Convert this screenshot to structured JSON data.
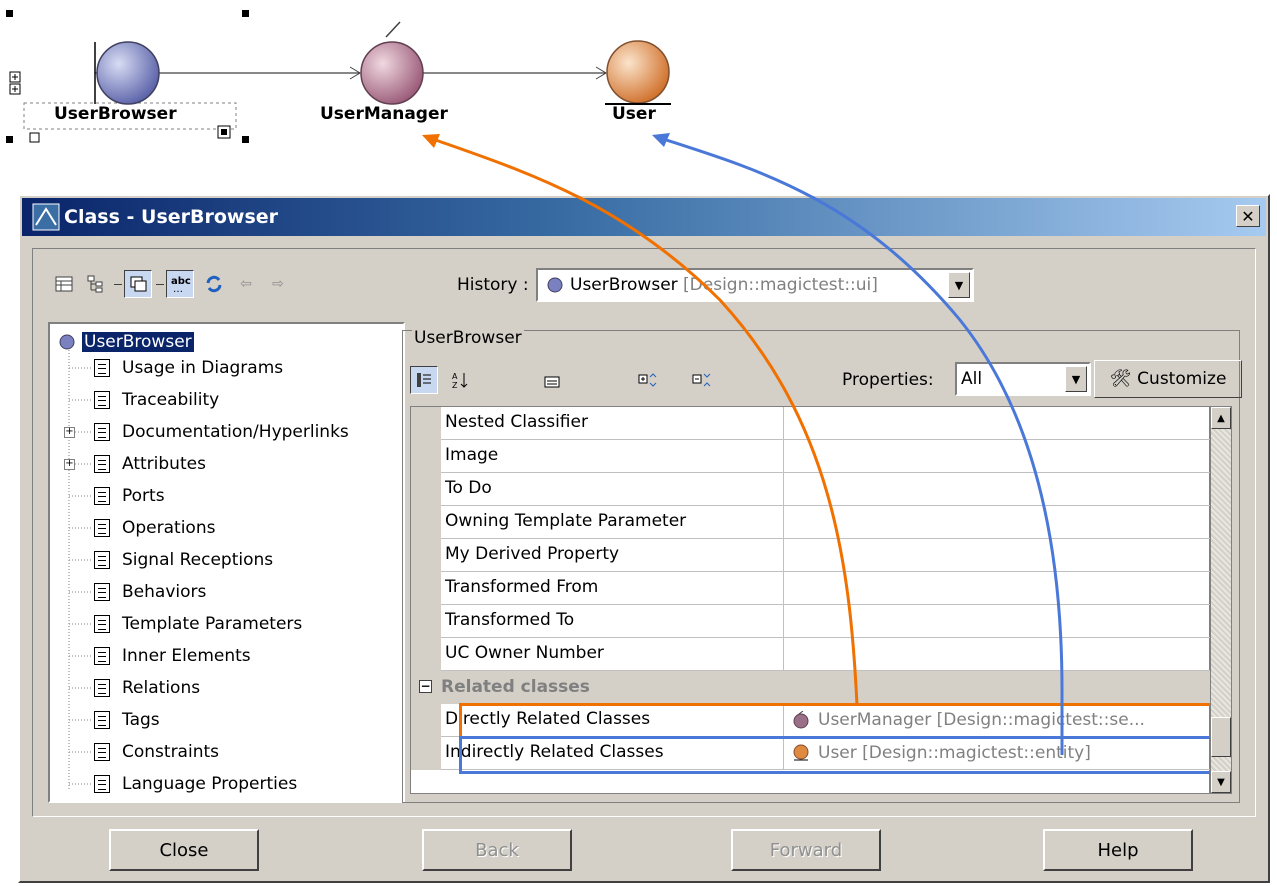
{
  "diagram": {
    "elements": [
      {
        "label": "UserBrowser",
        "kind": "boundary"
      },
      {
        "label": "UserManager",
        "kind": "control"
      },
      {
        "label": "User",
        "kind": "entity"
      }
    ]
  },
  "dialog": {
    "title": "Class - UserBrowser",
    "close_glyph": "✕",
    "toolbar": {
      "icons": [
        "table-view-icon",
        "tree-view-icon",
        "window-icon",
        "abc-icon",
        "refresh-icon",
        "back-arrow-icon",
        "forward-arrow-icon"
      ],
      "history_label": "History :",
      "history_value": "UserBrowser",
      "history_path": "[Design::magictest::ui]"
    },
    "tree": {
      "root": "UserBrowser",
      "items": [
        {
          "label": "Usage in Diagrams",
          "expandable": false
        },
        {
          "label": "Traceability",
          "expandable": false
        },
        {
          "label": "Documentation/Hyperlinks",
          "expandable": true
        },
        {
          "label": "Attributes",
          "expandable": true
        },
        {
          "label": "Ports",
          "expandable": false
        },
        {
          "label": "Operations",
          "expandable": false
        },
        {
          "label": "Signal Receptions",
          "expandable": false
        },
        {
          "label": "Behaviors",
          "expandable": false
        },
        {
          "label": "Template Parameters",
          "expandable": false
        },
        {
          "label": "Inner Elements",
          "expandable": false
        },
        {
          "label": "Relations",
          "expandable": false
        },
        {
          "label": "Tags",
          "expandable": false
        },
        {
          "label": "Constraints",
          "expandable": false
        },
        {
          "label": "Language Properties",
          "expandable": false
        }
      ]
    },
    "properties": {
      "group_title": "UserBrowser",
      "filter_label": "Properties:",
      "filter_value": "All",
      "customize_label": "Customize",
      "rows": [
        {
          "name": "Nested Classifier",
          "value": ""
        },
        {
          "name": "Image",
          "value": ""
        },
        {
          "name": "To Do",
          "value": ""
        },
        {
          "name": "Owning Template Parameter",
          "value": ""
        },
        {
          "name": "My Derived Property",
          "value": ""
        },
        {
          "name": "Transformed From",
          "value": ""
        },
        {
          "name": "Transformed To",
          "value": ""
        },
        {
          "name": "UC Owner Number",
          "value": ""
        }
      ],
      "category": "Related classes",
      "related": [
        {
          "name": "Directly Related Classes",
          "value": "UserManager [Design::magictest::se...",
          "highlight": "#f07000"
        },
        {
          "name": "Indirectly Related Classes",
          "value": "User [Design::magictest::entity]",
          "highlight": "#4a78d8"
        }
      ]
    },
    "buttons": {
      "close": "Close",
      "back": "Back",
      "forward": "Forward",
      "help": "Help"
    }
  },
  "colors": {
    "orange_arrow": "#f07000",
    "blue_arrow": "#4a78d8",
    "title_bar": "#0a246a"
  }
}
